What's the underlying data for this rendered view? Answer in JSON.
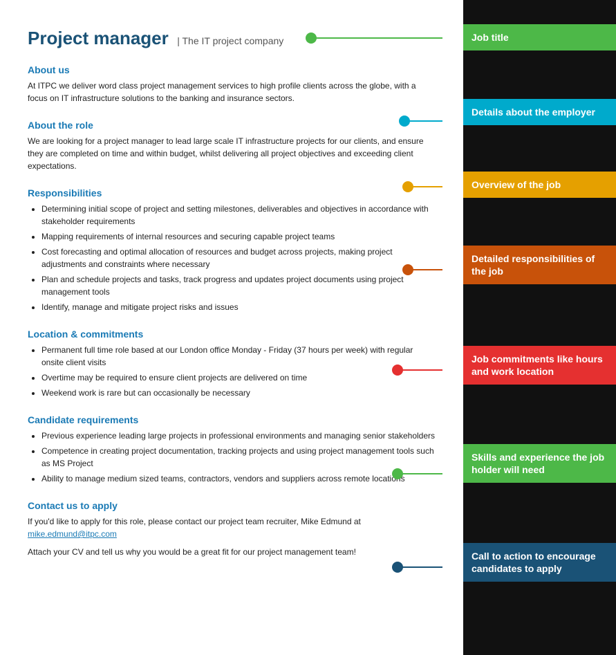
{
  "header": {
    "job_title": "Project manager",
    "separator": "|",
    "company": "The IT project company"
  },
  "sections": {
    "about_us": {
      "heading": "About us",
      "body": "At ITPC we deliver word class project management services to high profile clients across the globe, with a focus on IT infrastructure solutions to the banking and insurance sectors."
    },
    "about_role": {
      "heading": "About the role",
      "body": "We are looking for a project manager to lead large scale IT infrastructure projects for our clients, and ensure they are completed on time and within budget, whilst delivering all project objectives and exceeding client expectations."
    },
    "responsibilities": {
      "heading": "Responsibilities",
      "items": [
        "Determining initial scope of project and setting milestones, deliverables and objectives in accordance with stakeholder requirements",
        "Mapping requirements of internal resources and securing capable project teams",
        "Cost forecasting and optimal allocation of resources and budget across projects, making project adjustments and constraints where necessary",
        "Plan and schedule projects and tasks, track progress and updates project documents using project management tools",
        "Identify, manage and mitigate project risks and issues"
      ]
    },
    "location": {
      "heading": "Location & commitments",
      "items": [
        "Permanent full time role based at our London office Monday - Friday (37 hours per week) with regular onsite client visits",
        "Overtime may be required to ensure client projects are delivered on time",
        "Weekend work is rare but can occasionally be necessary"
      ]
    },
    "candidate": {
      "heading": "Candidate requirements",
      "items": [
        "Previous experience leading large projects in professional environments and managing senior stakeholders",
        "Competence in creating project documentation, tracking projects and using project management tools such as MS Project",
        "Ability to manage medium sized teams, contractors, vendors and suppliers across remote locations"
      ]
    },
    "contact": {
      "heading": "Contact us to apply",
      "body1": "If you'd like to apply for this role, please contact our project team recruiter, Mike Edmund at",
      "email": "mike.edmund@itpc.com",
      "body2": "Attach your CV and tell us why you would be a great fit for our project management team!"
    }
  },
  "annotations": {
    "job_title": "Job title",
    "employer_details": "Details about the employer",
    "job_overview": "Overview of the job",
    "responsibilities": "Detailed responsibilities of the job",
    "commitments": "Job commitments like hours and work location",
    "skills": "Skills and experience the job holder will need",
    "cta": "Call to action to encourage candidates to apply"
  },
  "colors": {
    "green": "#4db848",
    "cyan": "#00aacc",
    "yellow": "#e5a000",
    "orange": "#c8520a",
    "red": "#e53030",
    "green2": "#4db848",
    "blue": "#1a5276"
  }
}
